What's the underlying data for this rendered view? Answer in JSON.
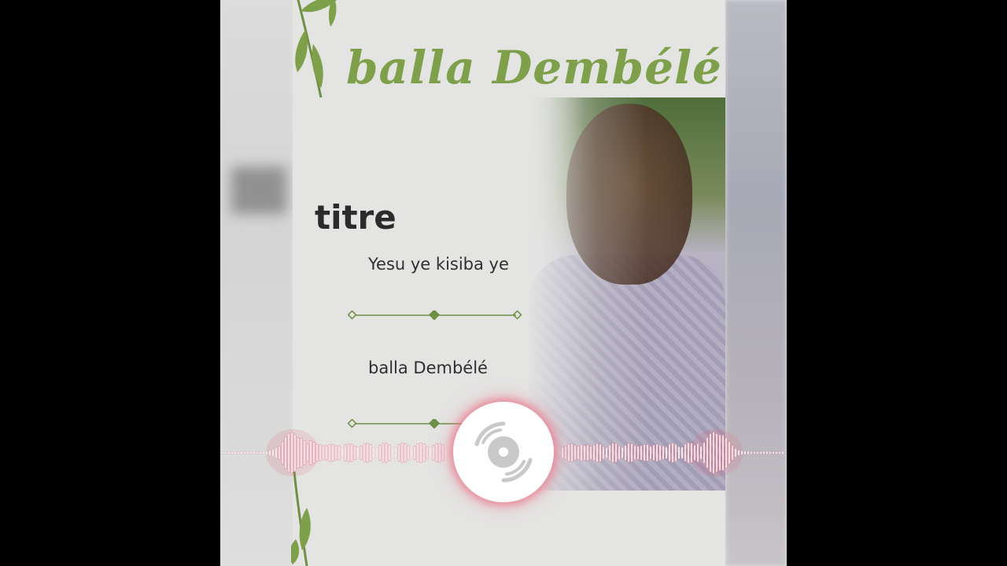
{
  "poster": {
    "title": "balla Dembélé",
    "heading": "titre",
    "song_title": "Yesu ye kisiba ye",
    "artist": "balla Dembélé"
  },
  "colors": {
    "accent_green": "#7fa04b",
    "divider_green": "#6f8f46",
    "visualizer_pink": "#e06a82",
    "background": "#000000"
  },
  "icons": {
    "disc": "disc-icon",
    "leaf": "leaf-icon"
  }
}
